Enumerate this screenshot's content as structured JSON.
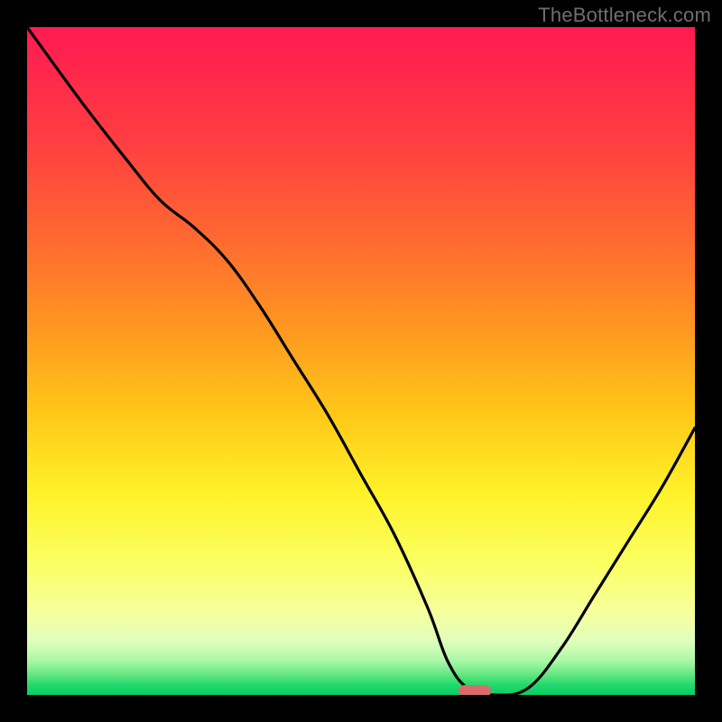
{
  "watermark": "TheBottleneck.com",
  "colors": {
    "background": "#000000",
    "marker": "#d96b6b",
    "curve": "#000000"
  },
  "chart_data": {
    "type": "line",
    "title": "",
    "xlabel": "",
    "ylabel": "",
    "xlim": [
      0,
      100
    ],
    "ylim": [
      0,
      100
    ],
    "grid": false,
    "x": [
      0,
      8,
      15,
      20,
      25,
      30,
      35,
      40,
      45,
      50,
      55,
      60,
      63,
      66,
      70,
      75,
      80,
      85,
      90,
      95,
      100
    ],
    "y_values": [
      100,
      89,
      80,
      74,
      70,
      65,
      58,
      50,
      42,
      33,
      24,
      13,
      5,
      1,
      0,
      1,
      7,
      15,
      23,
      31,
      40
    ],
    "marker": {
      "x": 67,
      "y": 0.5
    },
    "note": "Values are percent of plot height/width estimated from pixels; no numeric axis ticks are visible in the image."
  }
}
